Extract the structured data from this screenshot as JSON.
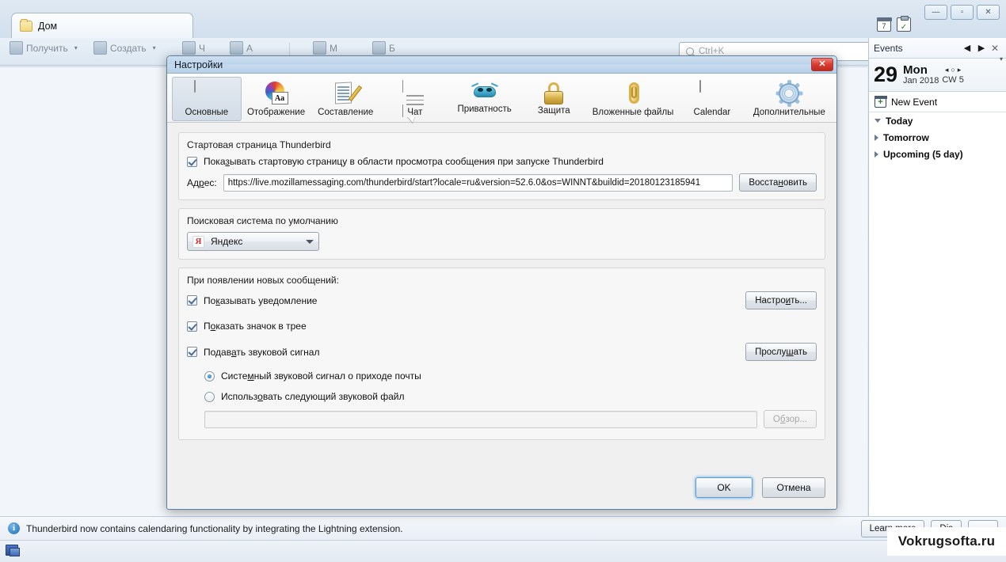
{
  "app": {
    "tab_label": "Дом",
    "window_controls": {
      "minimize": "—",
      "maximize": "▫",
      "close": "✕"
    }
  },
  "toolbar": {
    "get_mail": "Получить",
    "write": "Создать",
    "chat": "Ч",
    "address_book": "А",
    "tag": "М",
    "filter": "Б",
    "search_placeholder": "Ctrl+K"
  },
  "events": {
    "title": "Events",
    "prev": "◀",
    "next": "▶",
    "close": "✕",
    "day_number": "29",
    "day_of_week": "Mon",
    "month_year": "Jan 2018",
    "calendar_week": "CW 5",
    "nav_prev": "◂",
    "nav_today": "○",
    "nav_next": "▸",
    "new_event": "New Event",
    "groups": [
      {
        "label": "Today",
        "expanded": true
      },
      {
        "label": "Tomorrow",
        "expanded": false
      },
      {
        "label": "Upcoming (5 day)",
        "expanded": false
      }
    ]
  },
  "notification": {
    "text": "Thunderbird now contains calendaring functionality by integrating the Lightning extension.",
    "learn_more": "Learn more",
    "learn_more_accel": "m",
    "dismiss": "Dis",
    "dismiss_accel": "D"
  },
  "watermark": {
    "text": "Vokrugsofta.ru"
  },
  "dialog": {
    "title": "Настройки",
    "close_glyph": "✕",
    "tabs": [
      {
        "id": "general",
        "label": "Основные",
        "icon": "document-page-icon",
        "selected": true
      },
      {
        "id": "display",
        "label": "Отображение",
        "icon": "color-wheel-aa-icon",
        "selected": false
      },
      {
        "id": "compose",
        "label": "Составление",
        "icon": "pencil-paper-icon",
        "selected": false
      },
      {
        "id": "chat",
        "label": "Чат",
        "icon": "speech-bubble-icon",
        "selected": false
      },
      {
        "id": "privacy",
        "label": "Приватность",
        "icon": "mask-icon",
        "selected": false
      },
      {
        "id": "security",
        "label": "Защита",
        "icon": "padlock-icon",
        "selected": false
      },
      {
        "id": "attach",
        "label": "Вложенные файлы",
        "icon": "paperclip-icon",
        "selected": false
      },
      {
        "id": "calendar",
        "label": "Calendar",
        "icon": "calendar-icon",
        "selected": false
      },
      {
        "id": "advanced",
        "label": "Дополнительные",
        "icon": "gear-icon",
        "selected": false
      }
    ],
    "startpage": {
      "group_title": "Стартовая страница Thunderbird",
      "checkbox_label_a": "Пока",
      "checkbox_accel": "з",
      "checkbox_label_b": "ывать стартовую страницу в области просмотра сообщения при запуске Thunderbird",
      "checkbox_checked": true,
      "address_label_a": "Ад",
      "address_accel": "р",
      "address_label_b": "ес:",
      "address_value": "https://live.mozillamessaging.com/thunderbird/start?locale=ru&version=52.6.0&os=WINNT&buildid=20180123185941",
      "restore_button_a": "Восста",
      "restore_accel": "н",
      "restore_button_b": "овить"
    },
    "search_engine": {
      "group_title": "Поисковая система по умолчанию",
      "selected": "Яндекс",
      "icon_glyph": "Я"
    },
    "new_messages": {
      "group_title": "При появлении новых сообщений:",
      "show_notification": {
        "a": "По",
        "accel": "к",
        "b": "азывать уведомление",
        "checked": true
      },
      "show_tray_icon": {
        "a": "П",
        "accel": "о",
        "b": "казать значок в трее",
        "checked": true
      },
      "play_sound": {
        "a": "Подав",
        "accel": "а",
        "b": "ть звуковой сигнал",
        "checked": true
      },
      "radio_system": {
        "a": "Систе",
        "accel": "м",
        "b": "ный звуковой сигнал о приходе почты",
        "selected": true
      },
      "radio_file": {
        "a": "Использ",
        "accel": "о",
        "b": "вать следующий звуковой файл",
        "selected": false
      },
      "sound_file_value": "",
      "browse_button_a": "О",
      "browse_accel": "б",
      "browse_button_b": "зор...",
      "configure_button_a": "Настро",
      "configure_accel": "и",
      "configure_button_b": "ть...",
      "preview_button_a": "Прослу",
      "preview_accel": "ш",
      "preview_button_b": "ать"
    },
    "footer": {
      "ok": "OK",
      "cancel": "Отмена"
    }
  }
}
